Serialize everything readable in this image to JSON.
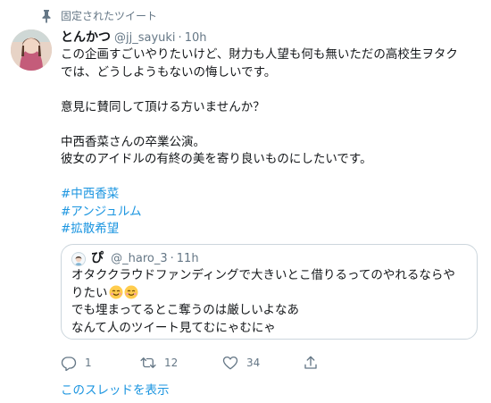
{
  "pinned": {
    "icon": "pin-icon",
    "label": "固定されたツイート"
  },
  "tweet": {
    "avatar_icon": "avatar",
    "display_name": "とんかつ",
    "handle": "@jj_sayuki",
    "separator": "·",
    "time": "10h",
    "lines": [
      "この企画すごいやりたいけど、財力も人望も何も無いただの高校生ヲタク",
      "では、どうしようもないの悔しいです。",
      "",
      "意見に賛同して頂ける方いませんか？",
      "",
      "中西香菜さんの卒業公演。",
      "彼女のアイドルの有終の美を寄り良いものにしたいです。",
      ""
    ],
    "hashtags": [
      "#中西香菜",
      "#アンジュルム",
      "#拡散希望"
    ]
  },
  "quote": {
    "avatar_icon": "avatar",
    "display_name": "ぴ",
    "handle": "@_haro_3",
    "separator": "·",
    "time": "11h",
    "line1": "オタククラウドファンディングで大きいとこ借りるってのやれるならや",
    "line2": "りたい",
    "emoji": "smiling-face-emoji",
    "line3": "でも埋まってるとこ奪うのは厳しいよなあ",
    "line4": "なんて人のツイート見てむにゃむにゃ"
  },
  "actions": {
    "reply_count": "1",
    "retweet_count": "12",
    "like_count": "34",
    "icons": [
      "reply-icon",
      "retweet-icon",
      "like-icon",
      "share-icon"
    ]
  },
  "thread_link": "このスレッドを表示",
  "colors": {
    "link": "#1b95e0",
    "muted": "#657786",
    "text": "#14171a",
    "border": "#ccd6dd"
  }
}
